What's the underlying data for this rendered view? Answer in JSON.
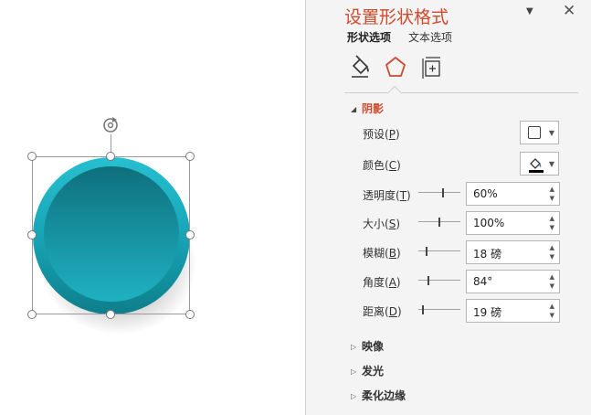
{
  "panel": {
    "title": "设置形状格式",
    "dropdown_glyph": "▼",
    "close_glyph": "✕",
    "tabs": [
      {
        "label": "形状选项",
        "active": true
      },
      {
        "label": "文本选项",
        "active": false
      }
    ],
    "icons": [
      "fill-line-icon",
      "effects-pentagon-icon",
      "size-properties-icon"
    ],
    "accent_color": "#d04a2c"
  },
  "shadow_section": {
    "title": "阴影",
    "expanded": true,
    "preset": {
      "label": "预设",
      "key": "P"
    },
    "color": {
      "label": "颜色",
      "key": "C",
      "value": "#000000"
    },
    "rows": [
      {
        "label": "透明度",
        "key": "T",
        "value": "60%",
        "slider": 0.6
      },
      {
        "label": "大小",
        "key": "S",
        "value": "100%",
        "slider": 0.5
      },
      {
        "label": "模糊",
        "key": "B",
        "value": "18 磅",
        "slider": 0.18
      },
      {
        "label": "角度",
        "key": "A",
        "value": "84°",
        "slider": 0.23
      },
      {
        "label": "距离",
        "key": "D",
        "value": "19 磅",
        "slider": 0.08
      }
    ]
  },
  "collapsed_sections": [
    {
      "title": "映像"
    },
    {
      "title": "发光"
    },
    {
      "title": "柔化边缘"
    }
  ],
  "shape": {
    "type": "circle",
    "colors": {
      "outer": "#1aa9ba",
      "inner": "#14899a"
    }
  }
}
